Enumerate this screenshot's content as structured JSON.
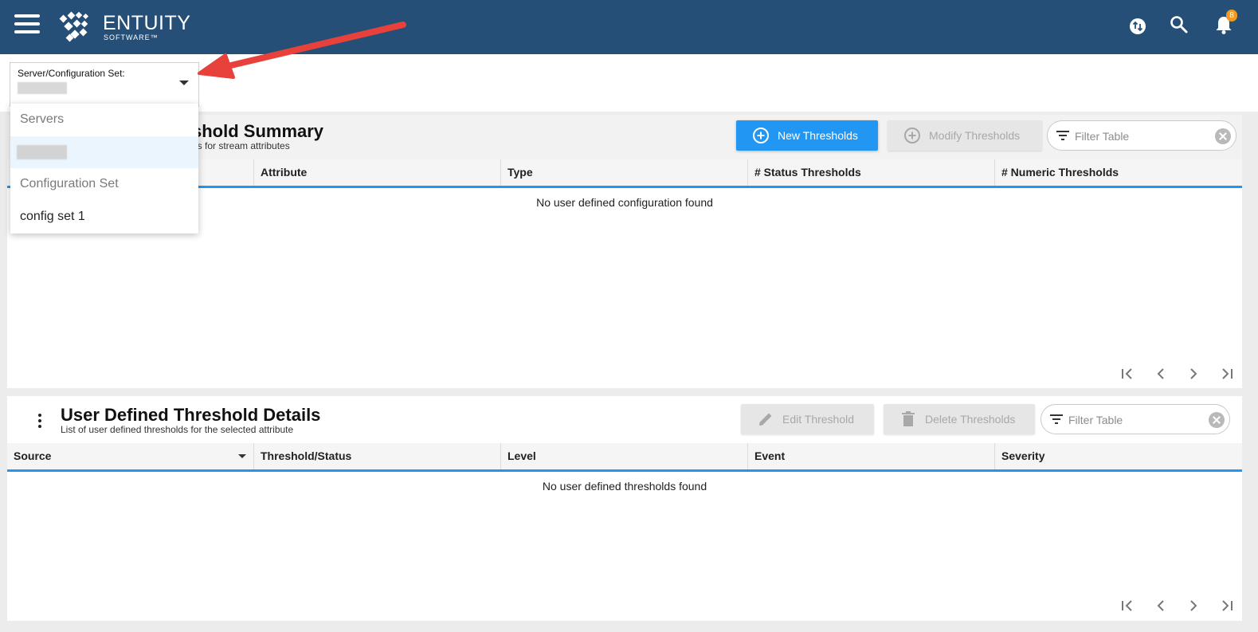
{
  "topbar": {
    "logo_name": "ENTUITY",
    "logo_sub": "SOFTWARE™",
    "notification_count": "8"
  },
  "selector": {
    "label": "Server/Configuration Set:"
  },
  "menu": {
    "group_servers": "Servers",
    "group_config": "Configuration Set",
    "config_item": "config set 1"
  },
  "summary": {
    "title_visible": "shold Summary",
    "subtitle_visible": "ds for stream attributes",
    "new_button": "New Thresholds",
    "modify_button": "Modify Thresholds",
    "filter_placeholder": "Filter Table",
    "columns": [
      "Attribute",
      "Type",
      "# Status Thresholds",
      "# Numeric Thresholds"
    ],
    "empty": "No user defined configuration found"
  },
  "details": {
    "title": "User Defined Threshold Details",
    "subtitle": "List of user defined thresholds for the selected attribute",
    "edit_button": "Edit Threshold",
    "delete_button": "Delete Thresholds",
    "filter_placeholder": "Filter Table",
    "columns": [
      "Source",
      "Threshold/Status",
      "Level",
      "Event",
      "Severity"
    ],
    "empty": "No user defined thresholds found"
  },
  "colors": {
    "topbar": "#254f77",
    "primary": "#2196f3",
    "annotation_arrow": "#e8413c",
    "badge": "#f29a1f"
  }
}
